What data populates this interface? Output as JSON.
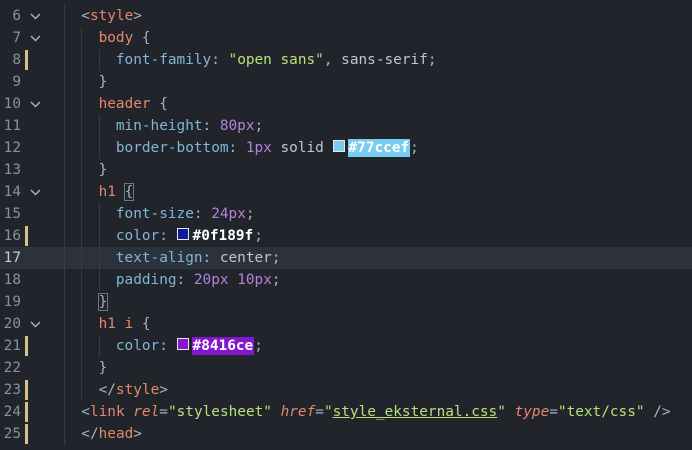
{
  "editor": {
    "lines": [
      {
        "num": "6",
        "indent": 1,
        "fold": true,
        "modified": false,
        "active": false,
        "tokens": [
          {
            "t": "<",
            "c": "punct"
          },
          {
            "t": "style",
            "c": "tag"
          },
          {
            "t": ">",
            "c": "punct"
          }
        ]
      },
      {
        "num": "7",
        "indent": 2,
        "fold": true,
        "modified": false,
        "active": false,
        "tokens": [
          {
            "t": "body",
            "c": "tag"
          },
          {
            "t": " {",
            "c": "punct"
          }
        ]
      },
      {
        "num": "8",
        "indent": 3,
        "fold": false,
        "modified": true,
        "active": false,
        "tokens": [
          {
            "t": "font-family",
            "c": "prop"
          },
          {
            "t": ": ",
            "c": "punct"
          },
          {
            "t": "\"open sans\"",
            "c": "str"
          },
          {
            "t": ", ",
            "c": "punct"
          },
          {
            "t": "sans-serif",
            "c": "plain"
          },
          {
            "t": ";",
            "c": "punct"
          }
        ]
      },
      {
        "num": "9",
        "indent": 2,
        "fold": false,
        "modified": false,
        "active": false,
        "tokens": [
          {
            "t": "}",
            "c": "punct"
          }
        ]
      },
      {
        "num": "10",
        "indent": 2,
        "fold": true,
        "modified": false,
        "active": false,
        "tokens": [
          {
            "t": "header",
            "c": "tag"
          },
          {
            "t": " {",
            "c": "punct"
          }
        ]
      },
      {
        "num": "11",
        "indent": 3,
        "fold": false,
        "modified": false,
        "active": false,
        "tokens": [
          {
            "t": "min-height",
            "c": "prop"
          },
          {
            "t": ": ",
            "c": "punct"
          },
          {
            "t": "80px",
            "c": "num"
          },
          {
            "t": ";",
            "c": "punct"
          }
        ]
      },
      {
        "num": "12",
        "indent": 3,
        "fold": false,
        "modified": false,
        "active": false,
        "tokens": [
          {
            "t": "border-bottom",
            "c": "prop"
          },
          {
            "t": ": ",
            "c": "punct"
          },
          {
            "t": "1px",
            "c": "num"
          },
          {
            "t": " solid ",
            "c": "plain"
          },
          {
            "t": "#77ccef",
            "c": "color",
            "color": "#77ccef",
            "fg": "#ffffff"
          },
          {
            "t": ";",
            "c": "punct"
          }
        ]
      },
      {
        "num": "13",
        "indent": 2,
        "fold": false,
        "modified": false,
        "active": false,
        "tokens": [
          {
            "t": "}",
            "c": "punct"
          }
        ]
      },
      {
        "num": "14",
        "indent": 2,
        "fold": true,
        "modified": false,
        "active": false,
        "tokens": [
          {
            "t": "h1",
            "c": "tag"
          },
          {
            "t": " ",
            "c": "punct"
          },
          {
            "t": "{",
            "c": "bracket"
          }
        ]
      },
      {
        "num": "15",
        "indent": 3,
        "fold": false,
        "modified": false,
        "active": false,
        "tokens": [
          {
            "t": "font-size",
            "c": "prop"
          },
          {
            "t": ": ",
            "c": "punct"
          },
          {
            "t": "24px",
            "c": "num"
          },
          {
            "t": ";",
            "c": "punct"
          }
        ]
      },
      {
        "num": "16",
        "indent": 3,
        "fold": false,
        "modified": true,
        "active": false,
        "tokens": [
          {
            "t": "color",
            "c": "prop"
          },
          {
            "t": ": ",
            "c": "punct"
          },
          {
            "t": "#0f189f",
            "c": "color",
            "color": "#0f189f",
            "fg": "#ffffff",
            "chipbg": "transparent"
          },
          {
            "t": ";",
            "c": "punct"
          }
        ]
      },
      {
        "num": "17",
        "indent": 3,
        "fold": false,
        "modified": false,
        "active": true,
        "tokens": [
          {
            "t": "text-align",
            "c": "prop"
          },
          {
            "t": ": ",
            "c": "punct"
          },
          {
            "t": "center",
            "c": "plain"
          },
          {
            "t": ";",
            "c": "punct"
          }
        ]
      },
      {
        "num": "18",
        "indent": 3,
        "fold": false,
        "modified": false,
        "active": false,
        "tokens": [
          {
            "t": "padding",
            "c": "prop"
          },
          {
            "t": ": ",
            "c": "punct"
          },
          {
            "t": "20px",
            "c": "num"
          },
          {
            "t": " ",
            "c": "punct"
          },
          {
            "t": "10px",
            "c": "num"
          },
          {
            "t": ";",
            "c": "punct"
          }
        ]
      },
      {
        "num": "19",
        "indent": 2,
        "fold": false,
        "modified": false,
        "active": false,
        "tokens": [
          {
            "t": "}",
            "c": "bracket"
          }
        ]
      },
      {
        "num": "20",
        "indent": 2,
        "fold": true,
        "modified": false,
        "active": false,
        "tokens": [
          {
            "t": "h1 i",
            "c": "tag"
          },
          {
            "t": " {",
            "c": "punct"
          }
        ]
      },
      {
        "num": "21",
        "indent": 3,
        "fold": false,
        "modified": true,
        "active": false,
        "tokens": [
          {
            "t": "color",
            "c": "prop"
          },
          {
            "t": ": ",
            "c": "punct"
          },
          {
            "t": "#8416ce",
            "c": "color",
            "color": "#8416ce",
            "fg": "#ffffff"
          },
          {
            "t": ";",
            "c": "punct"
          }
        ]
      },
      {
        "num": "22",
        "indent": 2,
        "fold": false,
        "modified": false,
        "active": false,
        "tokens": [
          {
            "t": "}",
            "c": "punct"
          }
        ]
      },
      {
        "num": "23",
        "indent": 2,
        "fold": false,
        "modified": true,
        "active": false,
        "tokens": [
          {
            "t": "</",
            "c": "punct"
          },
          {
            "t": "style",
            "c": "tag"
          },
          {
            "t": ">",
            "c": "punct"
          }
        ]
      },
      {
        "num": "24",
        "indent": 1,
        "fold": false,
        "modified": true,
        "active": false,
        "tokens": [
          {
            "t": "<",
            "c": "punct"
          },
          {
            "t": "link",
            "c": "tag"
          },
          {
            "t": " ",
            "c": "punct"
          },
          {
            "t": "rel",
            "c": "attr"
          },
          {
            "t": "=",
            "c": "punct"
          },
          {
            "t": "\"stylesheet\"",
            "c": "str"
          },
          {
            "t": " ",
            "c": "punct"
          },
          {
            "t": "href",
            "c": "attr"
          },
          {
            "t": "=",
            "c": "punct"
          },
          {
            "t": "\"",
            "c": "str"
          },
          {
            "t": "style_eksternal.css",
            "c": "url"
          },
          {
            "t": "\"",
            "c": "str"
          },
          {
            "t": " ",
            "c": "punct"
          },
          {
            "t": "type",
            "c": "attr"
          },
          {
            "t": "=",
            "c": "punct"
          },
          {
            "t": "\"text/css\"",
            "c": "str"
          },
          {
            "t": " />",
            "c": "punct"
          }
        ]
      },
      {
        "num": "25",
        "indent": 1,
        "fold": false,
        "modified": true,
        "active": false,
        "tokens": [
          {
            "t": "</",
            "c": "punct"
          },
          {
            "t": "head",
            "c": "tag"
          },
          {
            "t": ">",
            "c": "punct"
          }
        ]
      }
    ]
  }
}
